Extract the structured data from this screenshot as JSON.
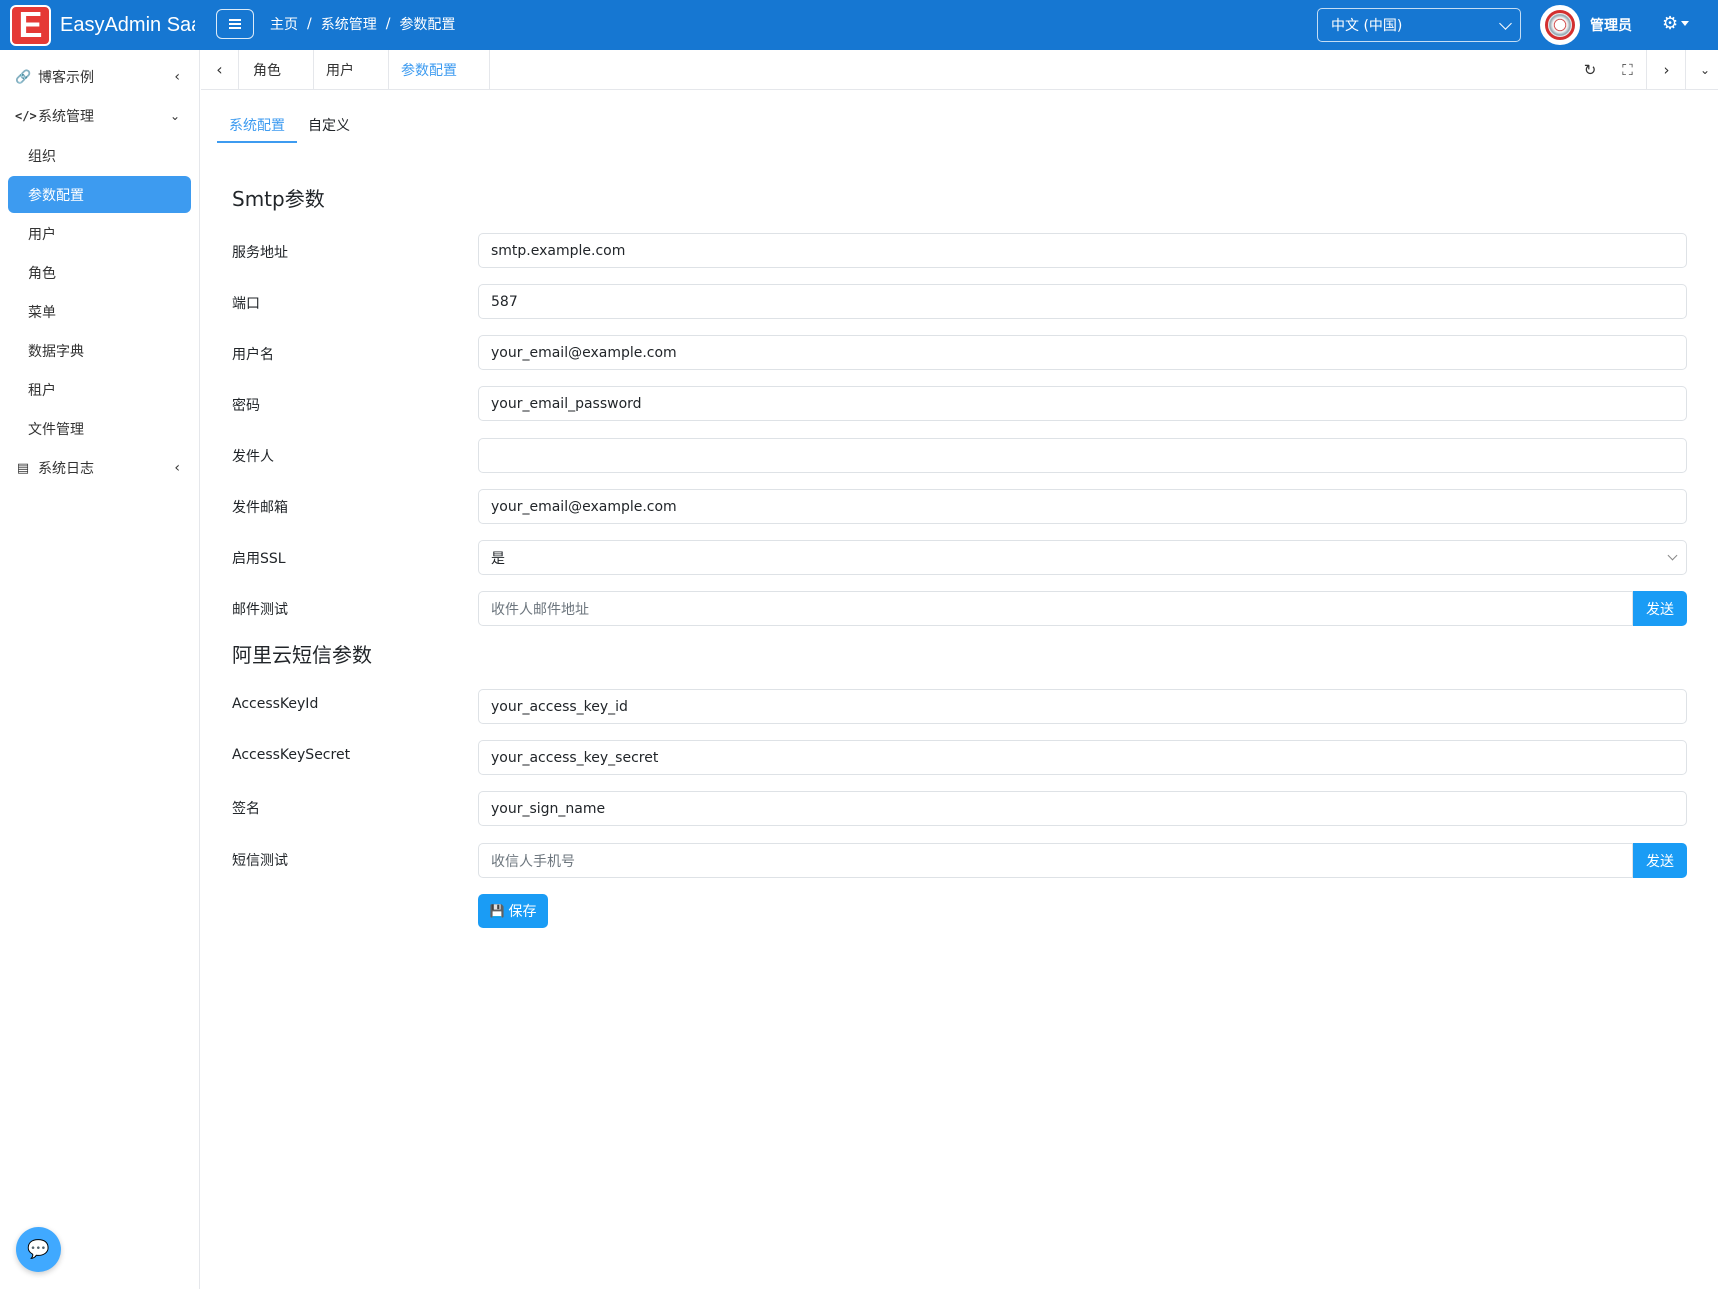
{
  "header": {
    "logo_letter": "E",
    "app_name": "EasyAdmin Saa",
    "breadcrumb": [
      "主页",
      "系统管理",
      "参数配置"
    ],
    "breadcrumb_sep": "/",
    "language": "中文 (中国)",
    "user_name": "管理员"
  },
  "sidebar": {
    "groups": [
      {
        "label": "博客示例",
        "icon": "link-icon"
      },
      {
        "label": "系统管理",
        "icon": "code-icon"
      },
      {
        "label": "系统日志",
        "icon": "server-icon"
      }
    ],
    "sub_items": [
      "组织",
      "参数配置",
      "用户",
      "角色",
      "菜单",
      "数据字典",
      "租户",
      "文件管理"
    ],
    "active_item": "参数配置"
  },
  "tabs": {
    "pages": [
      "角色",
      "用户",
      "参数配置"
    ],
    "active": "参数配置"
  },
  "subtabs": [
    "系统配置",
    "自定义"
  ],
  "smtp": {
    "title": "Smtp参数",
    "fields": [
      {
        "label": "服务地址",
        "value": "smtp.example.com"
      },
      {
        "label": "端口",
        "value": "587"
      },
      {
        "label": "用户名",
        "value": "your_email@example.com"
      },
      {
        "label": "密码",
        "value": "your_email_password"
      },
      {
        "label": "发件人",
        "value": ""
      },
      {
        "label": "发件邮箱",
        "value": "your_email@example.com"
      },
      {
        "label": "启用SSL",
        "value": "是"
      },
      {
        "label": "邮件测试",
        "placeholder": "收件人邮件地址",
        "button": "发送"
      }
    ]
  },
  "sms": {
    "title": "阿里云短信参数",
    "fields": [
      {
        "label": "AccessKeyId",
        "value": "your_access_key_id"
      },
      {
        "label": "AccessKeySecret",
        "value": "your_access_key_secret"
      },
      {
        "label": "签名",
        "value": "your_sign_name"
      },
      {
        "label": "短信测试",
        "placeholder": "收信人手机号",
        "button": "发送"
      }
    ]
  },
  "save_button": "保存",
  "colors": {
    "topbar": "#1677d2",
    "accent": "#3d9bf0",
    "button": "#1a9cf5"
  }
}
